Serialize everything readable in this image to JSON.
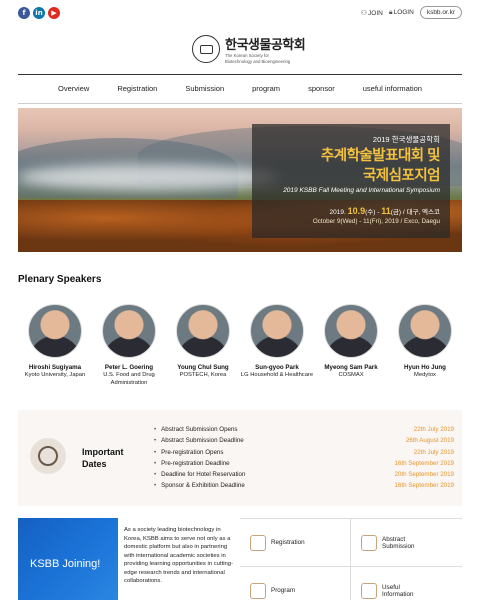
{
  "header": {
    "social": [
      "f",
      "in",
      "▶"
    ],
    "join_label": "JOIN",
    "login_label": "LOGIN",
    "site_label": "ksbb.or.kr"
  },
  "logo": {
    "ko": "한국생물공학회",
    "en1": "The Korean Society for",
    "en2": "Biotechnology and Bioengineering"
  },
  "nav": [
    "Overview",
    "Registration",
    "Submission",
    "program",
    "sponsor",
    "useful information"
  ],
  "hero": {
    "line1": "2019 한국생물공학회",
    "title1": "추계학술발표대회 및",
    "title2": "국제심포지엄",
    "subtitle": "2019 KSBB Fall Meeting and International Symposium",
    "date_prefix": "2019.",
    "date_start": "10.9",
    "date_mid": "(수) - ",
    "date_end": "11",
    "date_suffix": "(금)  /  대구, 엑스코",
    "date_en": "October 9(Wed) - 11(Fri), 2019  /  Exco, Daegu"
  },
  "speakers_title": "Plenary Speakers",
  "speakers": [
    {
      "name": "Hiroshi Sugiyama",
      "aff": "Kyoto University, Japan"
    },
    {
      "name": "Peter L. Goering",
      "aff": "U.S. Food and Drug Administration"
    },
    {
      "name": "Young Chul Sung",
      "aff": "POSTECH, Korea"
    },
    {
      "name": "Sun-gyoo Park",
      "aff": "LG Household & Healthcare"
    },
    {
      "name": "Myeong Sam Park",
      "aff": "COSMAX"
    },
    {
      "name": "Hyun Ho Jung",
      "aff": "Medytox"
    }
  ],
  "dates": {
    "title1": "Important",
    "title2": "Dates",
    "rows": [
      {
        "label": "Abstract Submission Opens",
        "value": "22th July 2019"
      },
      {
        "label": "Abstract Submission Deadline",
        "value": "26th August 2019"
      },
      {
        "label": "Pre-registration Opens",
        "value": "22th July 2019"
      },
      {
        "label": "Pre-registration Deadline",
        "value": "16th September 2019"
      },
      {
        "label": "Deadline for Hotel Reservation",
        "value": "20th September 2019"
      },
      {
        "label": "Sponsor & Exhibition Deadline",
        "value": "16th September 2019"
      }
    ]
  },
  "join": {
    "label": "KSBB Joining!",
    "text": "As a society leading biotechnology in Korea, KSBB aims to serve not only as a domestic platform but also in partnering with international academic societies in providing learning opportunities in cutting-edge research trends and international collaborations."
  },
  "quick_links": [
    "Registration",
    "Abstract Submission",
    "Program",
    "Useful Information"
  ]
}
